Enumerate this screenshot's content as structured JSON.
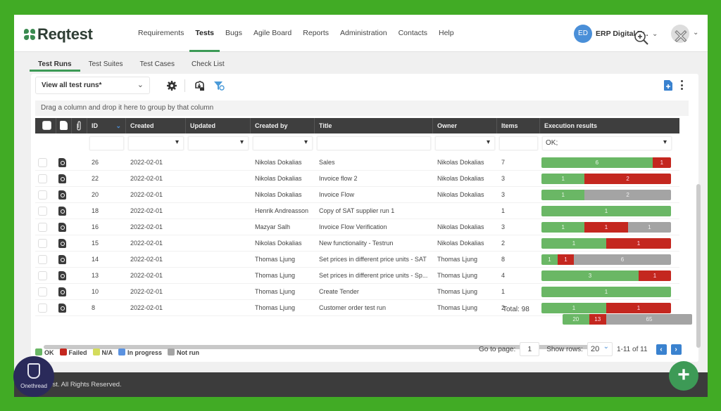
{
  "app": {
    "logo_text": "Reqtest",
    "nav": [
      "Requirements",
      "Tests",
      "Bugs",
      "Agile Board",
      "Reports",
      "Administration",
      "Contacts",
      "Help"
    ],
    "nav_active": "Tests",
    "user_initials": "ED",
    "user_name": "ERP Digital Tr..."
  },
  "subtabs": [
    "Test Runs",
    "Test Suites",
    "Test Cases",
    "Check List"
  ],
  "subtab_active": "Test Runs",
  "toolbar": {
    "view_select": "View all test runs*",
    "group_hint": "Drag a column and drop it here to group by that column"
  },
  "grid": {
    "headers": [
      "ID",
      "Created",
      "Updated",
      "Created by",
      "Title",
      "Owner",
      "Items",
      "Execution results"
    ],
    "execution_filter": "OK;",
    "rows": [
      {
        "id": "26",
        "created": "2022-02-01",
        "updated": "",
        "created_by": "Nikolas Dokalias",
        "title": "Sales",
        "owner": "Nikolas Dokalias",
        "items": "7",
        "results": {
          "ok": 6,
          "failed": 1,
          "notrun": 0
        }
      },
      {
        "id": "22",
        "created": "2022-02-01",
        "updated": "",
        "created_by": "Nikolas Dokalias",
        "title": "Invoice flow 2",
        "owner": "Nikolas Dokalias",
        "items": "3",
        "results": {
          "ok": 1,
          "failed": 2,
          "notrun": 0
        }
      },
      {
        "id": "20",
        "created": "2022-02-01",
        "updated": "",
        "created_by": "Nikolas Dokalias",
        "title": "Invoice Flow",
        "owner": "Nikolas Dokalias",
        "items": "3",
        "results": {
          "ok": 1,
          "failed": 0,
          "notrun": 2
        }
      },
      {
        "id": "18",
        "created": "2022-02-01",
        "updated": "",
        "created_by": "Henrik Andreasson",
        "title": "Copy of SAT supplier run 1",
        "owner": "",
        "items": "1",
        "results": {
          "ok": 1,
          "failed": 0,
          "notrun": 0
        }
      },
      {
        "id": "16",
        "created": "2022-02-01",
        "updated": "",
        "created_by": "Mazyar Salh",
        "title": "Invoice Flow Verification",
        "owner": "Nikolas Dokalias",
        "items": "3",
        "results": {
          "ok": 1,
          "failed": 1,
          "notrun": 1
        }
      },
      {
        "id": "15",
        "created": "2022-02-01",
        "updated": "",
        "created_by": "Nikolas Dokalias",
        "title": "New functionality - Testrun",
        "owner": "Nikolas Dokalias",
        "items": "2",
        "results": {
          "ok": 1,
          "failed": 1,
          "notrun": 0
        }
      },
      {
        "id": "14",
        "created": "2022-02-01",
        "updated": "",
        "created_by": "Thomas Ljung",
        "title": "Set prices in different price units - SAT",
        "owner": "Thomas Ljung",
        "items": "8",
        "results": {
          "ok": 1,
          "failed": 1,
          "notrun": 6
        }
      },
      {
        "id": "13",
        "created": "2022-02-01",
        "updated": "",
        "created_by": "Thomas Ljung",
        "title": "Set prices in different price units - Sp...",
        "owner": "Thomas Ljung",
        "items": "4",
        "results": {
          "ok": 3,
          "failed": 1,
          "notrun": 0
        }
      },
      {
        "id": "10",
        "created": "2022-02-01",
        "updated": "",
        "created_by": "Thomas Ljung",
        "title": "Create Tender",
        "owner": "Thomas Ljung",
        "items": "1",
        "results": {
          "ok": 1,
          "failed": 0,
          "notrun": 0
        }
      },
      {
        "id": "8",
        "created": "2022-02-01",
        "updated": "",
        "created_by": "Thomas Ljung",
        "title": "Customer order test run",
        "owner": "Thomas Ljung",
        "items": "2",
        "results": {
          "ok": 1,
          "failed": 1,
          "notrun": 0
        }
      }
    ],
    "total_label": "Total:  98",
    "total_results": {
      "ok": 20,
      "failed": 13,
      "notrun": 65
    }
  },
  "legend": [
    {
      "label": "OK",
      "color": "#6ab765"
    },
    {
      "label": "Failed",
      "color": "#c4271f"
    },
    {
      "label": "N/A",
      "color": "#d4dc5c"
    },
    {
      "label": "In progress",
      "color": "#5b92e0"
    },
    {
      "label": "Not run",
      "color": "#a4a4a4"
    }
  ],
  "pager": {
    "goto_label": "Go to page:",
    "page": "1",
    "rows_label": "Show rows:",
    "rows": "20",
    "range": "1-11 of 11"
  },
  "footer": {
    "text": "eqtest. All Rights Reserved.",
    "badge": "Onethread"
  },
  "colors": {
    "accent": "#3c9a56",
    "ok": "#6ab765",
    "failed": "#c4271f",
    "notrun": "#a4a4a4",
    "background": "#41ab25"
  }
}
